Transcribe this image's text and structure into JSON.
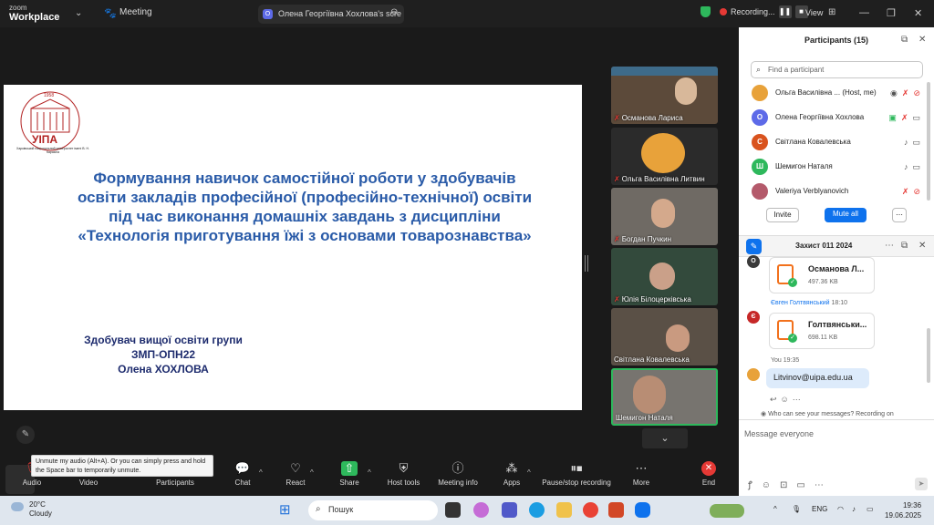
{
  "topbar": {
    "logo_line1": "zoom",
    "logo_line2": "Workplace",
    "meeting_label": "Meeting",
    "share_tab": "Олена Георгіївна Хохлова's scre",
    "recording": "Recording...",
    "view": "View"
  },
  "slide": {
    "logo_text": "УІПА",
    "logo_year": "1958",
    "logo_ring": "Українська інженерно-педагогічна академія",
    "logo_sub": "Харківський національний університет імені В. Н. Каразіна",
    "title_lines": [
      "Формування навичок самостійної роботи у здобувачів",
      "освіти закладів професійної (професійно-технічної) освіти",
      "під час виконання домашніх завдань з дисципліни",
      "«Технологія приготування їжі з основами товарознавства»"
    ],
    "student_lines": [
      "Здобувач вищої освіти групи",
      "ЗМП-ОПН22",
      "Олена ХОХЛОВА"
    ]
  },
  "videos": [
    {
      "name": "Османова Лариса",
      "bg": "#5c4a3a",
      "muted": true
    },
    {
      "name": "Ольга Василівна Литвин",
      "bg": "#2b2b2b",
      "muted": true
    },
    {
      "name": "Богдан Пучкин",
      "bg": "#6f6a64",
      "muted": true
    },
    {
      "name": "Юлія Білоцерківська",
      "bg": "#334a3c",
      "muted": true
    },
    {
      "name": "Світлана Ковалевська",
      "bg": "#5a5046",
      "muted": false
    },
    {
      "name": "Шемигон Наталя",
      "bg": "#77746f",
      "muted": false
    }
  ],
  "tooltip": "Unmute my audio (Alt+A). Or you can simply press and hold the Space bar to temporarily unmute.",
  "toolbar": {
    "audio": "Audio",
    "video": "Video",
    "participants": "Participants",
    "chat": "Chat",
    "react": "React",
    "share": "Share",
    "host_tools": "Host tools",
    "meeting_info": "Meeting info",
    "apps": "Apps",
    "pause_stop": "Pause/stop recording",
    "more": "More",
    "end": "End"
  },
  "participants": {
    "header": "Participants (15)",
    "search_placeholder": "Find a participant",
    "rows": [
      {
        "initial": "",
        "name": "Ольга Василівна ... (Host, me)",
        "color": "#e8a23a"
      },
      {
        "initial": "О",
        "name": "Олена Георгіївна Хохлова",
        "color": "#5d6ae8"
      },
      {
        "initial": "С",
        "name": "Світлана Ковалевська",
        "color": "#d9531e"
      },
      {
        "initial": "Ш",
        "name": "Шемигон Наталя",
        "color": "#2eb85c"
      },
      {
        "initial": "",
        "name": "Valeriya Verblyanovich",
        "color": "#b45a6b"
      }
    ],
    "invite": "Invite",
    "mute_all": "Mute all"
  },
  "chat": {
    "title": "Захист 011 2024",
    "file1_name": "Османова Л...",
    "file1_size": "497.36 KB",
    "sender2": "Євген Голтвянський",
    "sender2_time": "18:10",
    "file2_name": "Голтвянськи...",
    "file2_size": "698.11 KB",
    "you_label": "You 19:35",
    "message": "Litvinov@uipa.edu.ua",
    "who_can_see": "Who can see your messages? Recording on",
    "input_placeholder": "Message everyone"
  },
  "taskbar": {
    "temp": "20°C",
    "weather": "Cloudy",
    "search": "Пошук",
    "lang": "ENG",
    "time": "19:36",
    "date": "19.06.2025"
  }
}
